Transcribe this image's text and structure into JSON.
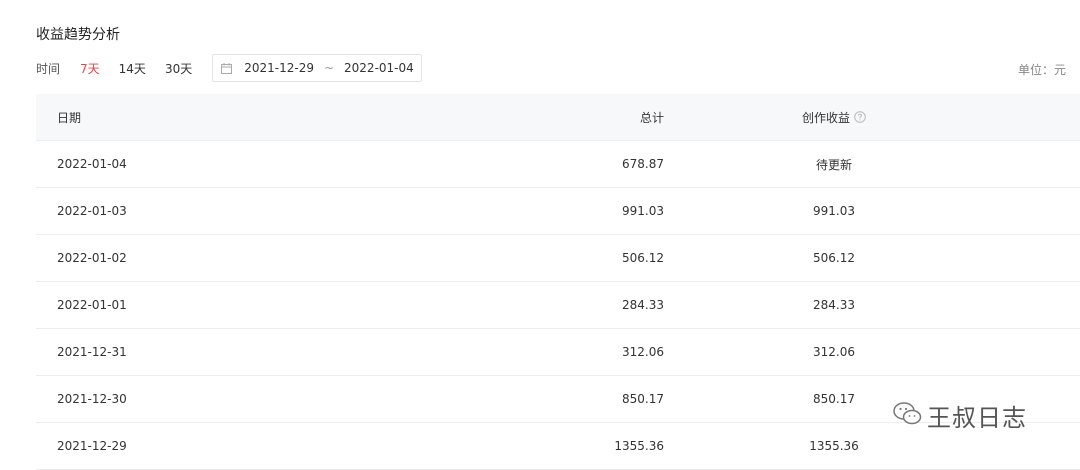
{
  "page": {
    "title": "收益趋势分析"
  },
  "filter": {
    "label": "时间",
    "periods": [
      {
        "label": "7天",
        "active": true
      },
      {
        "label": "14天",
        "active": false
      },
      {
        "label": "30天",
        "active": false
      }
    ],
    "date_range": {
      "start": "2021-12-29",
      "separator": "~",
      "end": "2022-01-04"
    },
    "unit": "单位：元"
  },
  "table": {
    "headers": {
      "date": "日期",
      "total": "总计",
      "creative": "创作收益"
    },
    "rows": [
      {
        "date": "2022-01-04",
        "total": "678.87",
        "creative": "待更新"
      },
      {
        "date": "2022-01-03",
        "total": "991.03",
        "creative": "991.03"
      },
      {
        "date": "2022-01-02",
        "total": "506.12",
        "creative": "506.12"
      },
      {
        "date": "2022-01-01",
        "total": "284.33",
        "creative": "284.33"
      },
      {
        "date": "2021-12-31",
        "total": "312.06",
        "creative": "312.06"
      },
      {
        "date": "2021-12-30",
        "total": "850.17",
        "creative": "850.17"
      },
      {
        "date": "2021-12-29",
        "total": "1355.36",
        "creative": "1355.36"
      }
    ]
  },
  "watermark": {
    "text": "王叔日志",
    "icon": "wechat-icon"
  },
  "colors": {
    "accent": "#f04142",
    "header_bg": "#f7f8fa",
    "border": "#eeeeee"
  }
}
